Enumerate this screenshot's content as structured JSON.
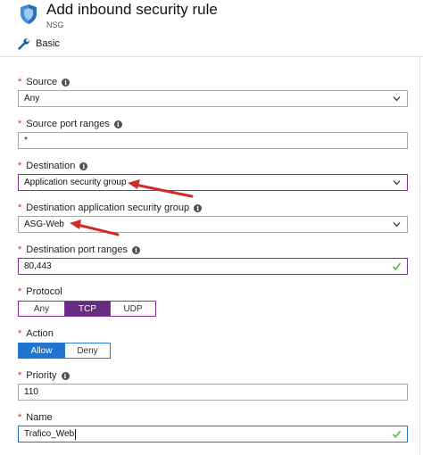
{
  "header": {
    "title": "Add inbound security rule",
    "subtitle": "NSG",
    "icon": "shield-icon"
  },
  "toolbar": {
    "basic_label": "Basic",
    "basic_icon": "wrench-icon"
  },
  "form": {
    "source": {
      "label": "Source",
      "value": "Any",
      "required": true
    },
    "source_port_ranges": {
      "label": "Source port ranges",
      "value": "*",
      "required": true
    },
    "destination": {
      "label": "Destination",
      "value": "Application security group",
      "required": true
    },
    "destination_asg": {
      "label": "Destination application security group",
      "value": "ASG-Web",
      "required": true
    },
    "destination_port_ranges": {
      "label": "Destination port ranges",
      "value": "80,443",
      "required": true
    },
    "protocol": {
      "label": "Protocol",
      "options": [
        "Any",
        "TCP",
        "UDP"
      ],
      "selected": "TCP",
      "required": true
    },
    "action": {
      "label": "Action",
      "options": [
        "Allow",
        "Deny"
      ],
      "selected": "Allow",
      "required": true
    },
    "priority": {
      "label": "Priority",
      "value": "110",
      "required": true
    },
    "name": {
      "label": "Name",
      "value": "Trafico_Web",
      "required": true
    }
  },
  "colors": {
    "required_star": "#d42f2f",
    "protocol_accent": "#672b82",
    "action_accent": "#1f74d2",
    "valid_check": "#6cb33e",
    "annotation_arrow": "#d12a2a"
  }
}
